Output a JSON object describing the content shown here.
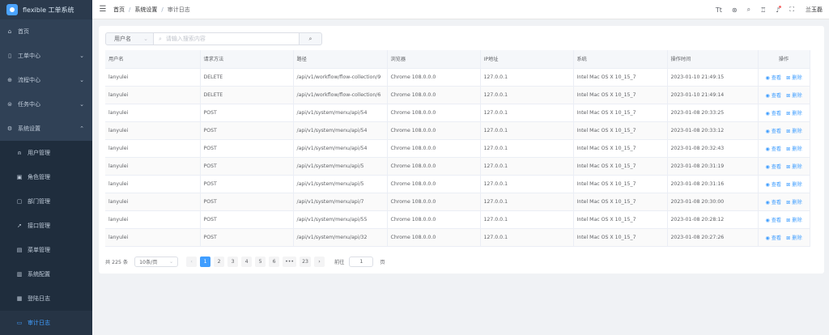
{
  "app": {
    "title": "flexible 工单系统"
  },
  "sidebar": {
    "items": [
      {
        "label": "首页",
        "icon": "home-icon",
        "glyph": "⌂",
        "arrow": ""
      },
      {
        "label": "工单中心",
        "icon": "ticket-icon",
        "glyph": "▯",
        "arrow": "⌄"
      },
      {
        "label": "流程中心",
        "icon": "flow-icon",
        "glyph": "⊕",
        "arrow": "⌄"
      },
      {
        "label": "任务中心",
        "icon": "task-icon",
        "glyph": "⊜",
        "arrow": "⌄"
      },
      {
        "label": "系统设置",
        "icon": "settings-icon",
        "glyph": "⚙",
        "arrow": "⌃"
      }
    ],
    "sub_items": [
      {
        "label": "用户管理",
        "icon": "user-icon",
        "glyph": "⍝"
      },
      {
        "label": "角色管理",
        "icon": "role-icon",
        "glyph": "▣"
      },
      {
        "label": "部门管理",
        "icon": "department-icon",
        "glyph": "▢"
      },
      {
        "label": "接口管理",
        "icon": "api-icon",
        "glyph": "➚"
      },
      {
        "label": "菜单管理",
        "icon": "menu-icon",
        "glyph": "▤"
      },
      {
        "label": "系统配置",
        "icon": "config-icon",
        "glyph": "▥"
      },
      {
        "label": "登陆日志",
        "icon": "login-log-icon",
        "glyph": "▦"
      },
      {
        "label": "审计日志",
        "icon": "audit-log-icon",
        "glyph": "▭"
      }
    ]
  },
  "header": {
    "breadcrumb": [
      "首页",
      "系统设置",
      "审计日志"
    ],
    "username": "兰玉磊"
  },
  "search": {
    "field": "用户名",
    "placeholder": "请输入搜索内容"
  },
  "table": {
    "columns": [
      "用户名",
      "请求方法",
      "路径",
      "浏览器",
      "IP地址",
      "系统",
      "操作时间",
      "操作"
    ],
    "view_label": "查看",
    "delete_label": "删除",
    "rows": [
      [
        "lanyulei",
        "DELETE",
        "/api/v1/workflow/flow-collection/9",
        "Chrome 108.0.0.0",
        "127.0.0.1",
        "Intel Mac OS X 10_15_7",
        "2023-01-10 21:49:15"
      ],
      [
        "lanyulei",
        "DELETE",
        "/api/v1/workflow/flow-collection/6",
        "Chrome 108.0.0.0",
        "127.0.0.1",
        "Intel Mac OS X 10_15_7",
        "2023-01-10 21:49:14"
      ],
      [
        "lanyulei",
        "POST",
        "/api/v1/system/menu/api/54",
        "Chrome 108.0.0.0",
        "127.0.0.1",
        "Intel Mac OS X 10_15_7",
        "2023-01-08 20:33:25"
      ],
      [
        "lanyulei",
        "POST",
        "/api/v1/system/menu/api/54",
        "Chrome 108.0.0.0",
        "127.0.0.1",
        "Intel Mac OS X 10_15_7",
        "2023-01-08 20:33:12"
      ],
      [
        "lanyulei",
        "POST",
        "/api/v1/system/menu/api/54",
        "Chrome 108.0.0.0",
        "127.0.0.1",
        "Intel Mac OS X 10_15_7",
        "2023-01-08 20:32:43"
      ],
      [
        "lanyulei",
        "POST",
        "/api/v1/system/menu/api/5",
        "Chrome 108.0.0.0",
        "127.0.0.1",
        "Intel Mac OS X 10_15_7",
        "2023-01-08 20:31:19"
      ],
      [
        "lanyulei",
        "POST",
        "/api/v1/system/menu/api/5",
        "Chrome 108.0.0.0",
        "127.0.0.1",
        "Intel Mac OS X 10_15_7",
        "2023-01-08 20:31:16"
      ],
      [
        "lanyulei",
        "POST",
        "/api/v1/system/menu/api/7",
        "Chrome 108.0.0.0",
        "127.0.0.1",
        "Intel Mac OS X 10_15_7",
        "2023-01-08 20:30:00"
      ],
      [
        "lanyulei",
        "POST",
        "/api/v1/system/menu/api/55",
        "Chrome 108.0.0.0",
        "127.0.0.1",
        "Intel Mac OS X 10_15_7",
        "2023-01-08 20:28:12"
      ],
      [
        "lanyulei",
        "POST",
        "/api/v1/system/menu/api/32",
        "Chrome 108.0.0.0",
        "127.0.0.1",
        "Intel Mac OS X 10_15_7",
        "2023-01-08 20:27:26"
      ]
    ]
  },
  "pagination": {
    "total_label": "共 225 条",
    "page_size": "10条/页",
    "pages": [
      "1",
      "2",
      "3",
      "4",
      "5",
      "6",
      "•••",
      "23"
    ],
    "current": "1",
    "goto_label": "前往",
    "goto_value": "1",
    "goto_suffix": "页"
  },
  "colors": {
    "accent": "#409eff",
    "sidebar": "#304156"
  }
}
